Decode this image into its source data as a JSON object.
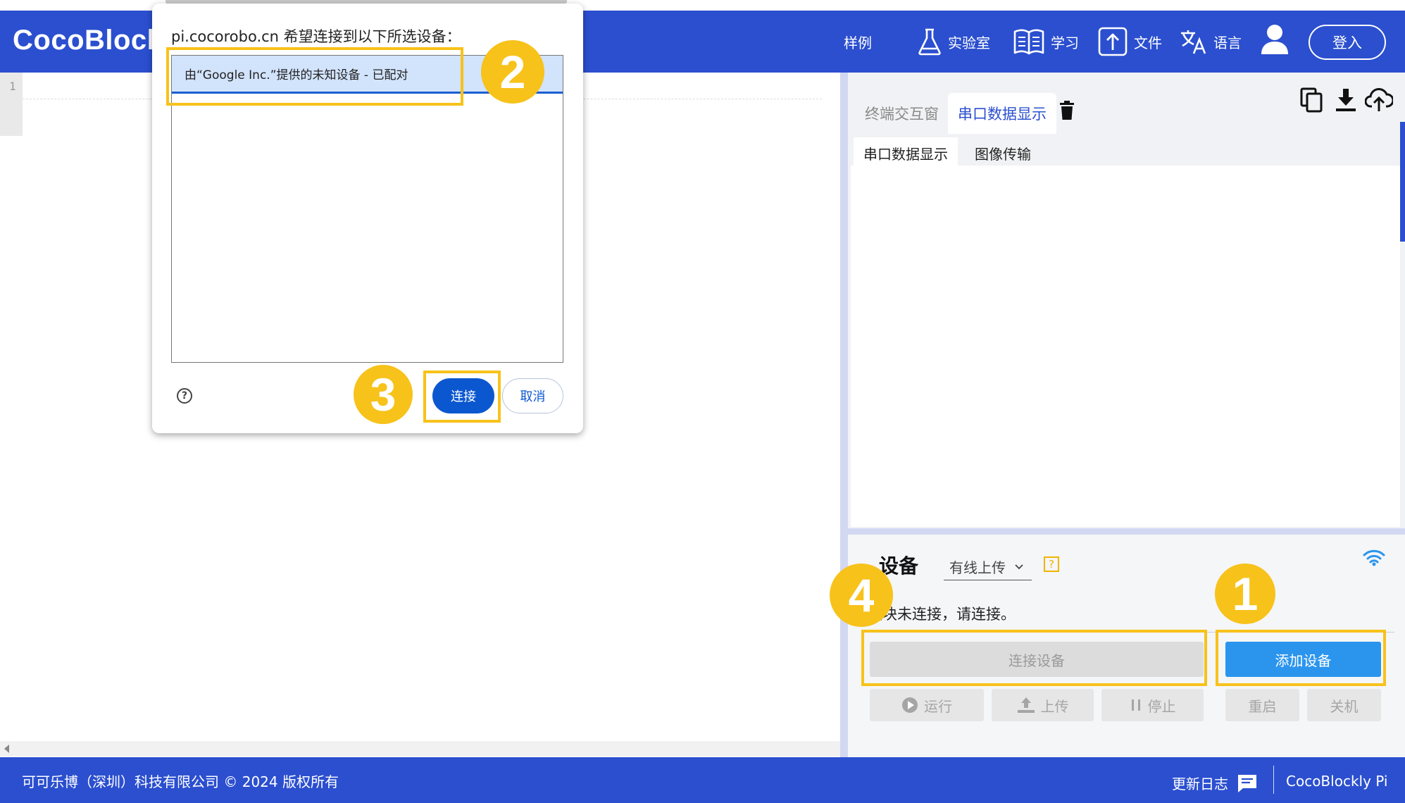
{
  "header": {
    "brand": "CocoBlock",
    "nav": [
      {
        "label": "样例",
        "icon": ""
      },
      {
        "label": "实验室",
        "icon": "flask-icon"
      },
      {
        "label": "学习",
        "icon": "book-icon"
      },
      {
        "label": "文件",
        "icon": "file-upload-icon"
      },
      {
        "label": "语言",
        "icon": "translate-icon"
      }
    ],
    "user_icon": "user-icon",
    "login_label": "登入"
  },
  "editor": {
    "line_number": "1"
  },
  "panel": {
    "tabs": [
      "终端交互窗",
      "串口数据显示"
    ],
    "active_tab": "串口数据显示",
    "subtabs": [
      "串口数据显示",
      "图像传输"
    ],
    "active_subtab": "串口数据显示",
    "tool_icons": [
      "trash-icon",
      "copy-icon",
      "download-icon",
      "cloud-upload-icon"
    ]
  },
  "device": {
    "title": "设备",
    "upload_mode": "有线上传",
    "help_mark": "?",
    "status": "模块未连接，请连接。",
    "connect_label": "连接设备",
    "add_label": "添加设备",
    "controls": [
      "运行",
      "上传",
      "停止"
    ],
    "power": [
      "重启",
      "关机"
    ]
  },
  "dialog": {
    "title": "pi.cocorobo.cn 希望连接到以下所选设备：",
    "device_item": "由“Google Inc.”提供的未知设备 - 已配对",
    "help_mark": "?",
    "connect_label": "连接",
    "cancel_label": "取消"
  },
  "annotations": [
    "1",
    "2",
    "3",
    "4"
  ],
  "footer": {
    "copyright": "可可乐博（深圳）科技有限公司 © 2024 版权所有",
    "changelog": "更新日志",
    "brand": "CocoBlockly Pi"
  },
  "colors": {
    "primary": "#2b4fcf",
    "accent_blue": "#2b95ee",
    "highlight": "#f7c21a",
    "dialog_button": "#0b57d0"
  }
}
